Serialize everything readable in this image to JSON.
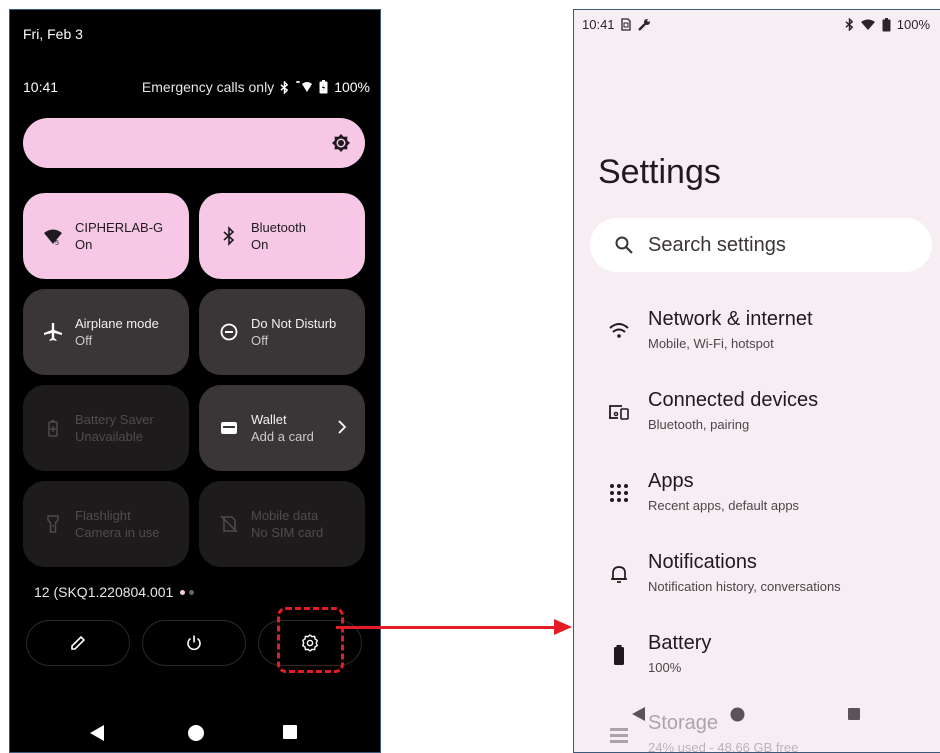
{
  "left_phone": {
    "date": "Fri, Feb 3",
    "time": "10:41",
    "status_text": "Emergency calls only",
    "battery": "100%",
    "tiles": [
      {
        "title": "CIPHERLAB-G",
        "subtitle": "On",
        "icon": "wifi-icon"
      },
      {
        "title": "Bluetooth",
        "subtitle": "On",
        "icon": "bluetooth-icon"
      },
      {
        "title": "Airplane mode",
        "subtitle": "Off",
        "icon": "airplane-icon"
      },
      {
        "title": "Do Not Disturb",
        "subtitle": "Off",
        "icon": "do-not-disturb-icon"
      },
      {
        "title": "Battery Saver",
        "subtitle": "Unavailable",
        "icon": "battery-saver-icon"
      },
      {
        "title": "Wallet",
        "subtitle": "Add a card",
        "icon": "wallet-icon"
      },
      {
        "title": "Flashlight",
        "subtitle": "Camera in use",
        "icon": "flashlight-icon"
      },
      {
        "title": "Mobile data",
        "subtitle": "No SIM card",
        "icon": "mobile-data-off-icon"
      }
    ],
    "build_number": "12 (SKQ1.220804.001",
    "colors": {
      "tile_on": "#f7c8e5",
      "tile_off": "#3a3638",
      "highlight": "#e51c23"
    }
  },
  "right_phone": {
    "time": "10:41",
    "battery": "100%",
    "title": "Settings",
    "search_placeholder": "Search settings",
    "items": [
      {
        "title": "Network & internet",
        "subtitle": "Mobile, Wi-Fi, hotspot",
        "icon": "wifi-icon"
      },
      {
        "title": "Connected devices",
        "subtitle": "Bluetooth, pairing",
        "icon": "connected-devices-icon"
      },
      {
        "title": "Apps",
        "subtitle": "Recent apps, default apps",
        "icon": "apps-grid-icon"
      },
      {
        "title": "Notifications",
        "subtitle": "Notification history, conversations",
        "icon": "bell-icon"
      },
      {
        "title": "Battery",
        "subtitle": "100%",
        "icon": "battery-icon"
      },
      {
        "title": "Storage",
        "subtitle": "24% used - 48.66 GB free",
        "icon": "storage-icon"
      }
    ],
    "colors": {
      "background": "#f7eef3"
    }
  }
}
